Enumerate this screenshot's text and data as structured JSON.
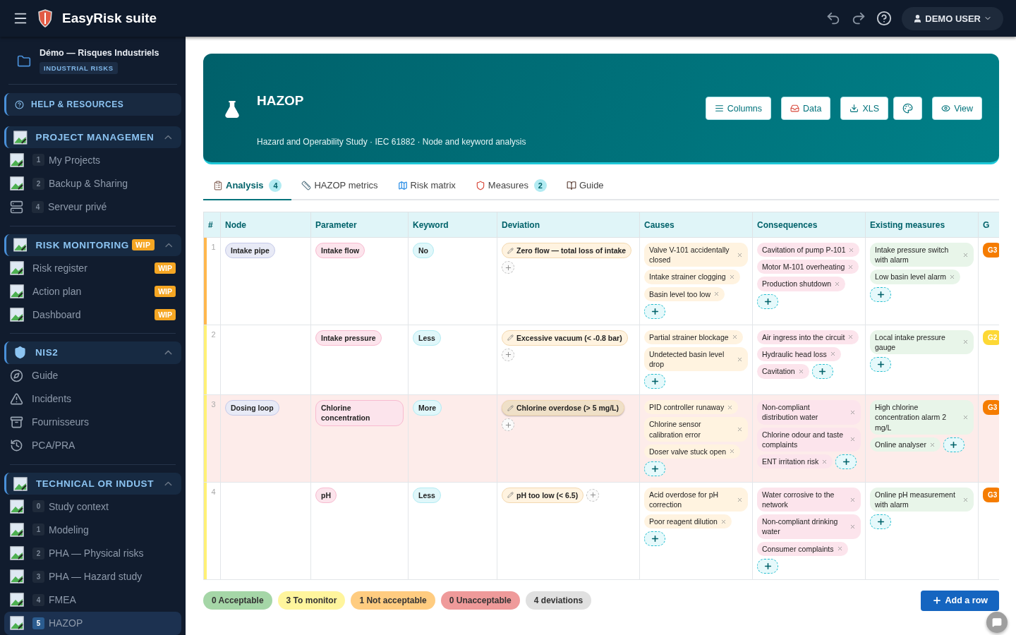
{
  "app": {
    "title": "EasyRisk suite",
    "user": "DEMO USER"
  },
  "project": {
    "name": "Démo — Risques Industriels",
    "tag": "INDUSTRIAL RISKS"
  },
  "help": {
    "label": "HELP & RESOURCES"
  },
  "sidebar": {
    "sections": [
      {
        "title": "PROJECT MANAGEMEN",
        "kind": "image",
        "expanded": true,
        "items": [
          {
            "label": "My Projects",
            "number": "1",
            "kind": "image",
            "selected": false
          },
          {
            "label": "Backup & Sharing",
            "number": "2",
            "kind": "image",
            "selected": false
          },
          {
            "label": "Serveur privé",
            "number": "4",
            "kind": "server",
            "selected": false
          }
        ]
      },
      {
        "title": "RISK MONITORING",
        "badge": "WIP",
        "kind": "image",
        "expanded": true,
        "items": [
          {
            "label": "Risk register",
            "badge": "WIP",
            "kind": "image",
            "selected": false
          },
          {
            "label": "Action plan",
            "badge": "WIP",
            "kind": "image",
            "selected": false
          },
          {
            "label": "Dashboard",
            "badge": "WIP",
            "kind": "image",
            "selected": false
          }
        ]
      },
      {
        "title": "NIS2",
        "kind": "shield",
        "expanded": true,
        "items": [
          {
            "label": "Guide",
            "kind": "compass",
            "selected": false
          },
          {
            "label": "Incidents",
            "kind": "warning",
            "selected": false
          },
          {
            "label": "Fournisseurs",
            "kind": "archive",
            "selected": false
          },
          {
            "label": "PCA/PRA",
            "kind": "history",
            "selected": false
          }
        ]
      },
      {
        "title": "TECHNICAL OR INDUST",
        "kind": "image",
        "expanded": true,
        "items": [
          {
            "label": "Study context",
            "number": "0",
            "kind": "image",
            "selected": false
          },
          {
            "label": "Modeling",
            "number": "1",
            "kind": "image",
            "selected": false
          },
          {
            "label": "PHA — Physical risks",
            "number": "2",
            "kind": "image",
            "selected": false
          },
          {
            "label": "PHA — Hazard study",
            "number": "3",
            "kind": "image",
            "selected": false
          },
          {
            "label": "FMEA",
            "number": "4",
            "kind": "image",
            "selected": false
          },
          {
            "label": "HAZOP",
            "number": "5",
            "kind": "image",
            "selected": true
          }
        ]
      }
    ]
  },
  "hero": {
    "title": "HAZOP",
    "subtitle": "Hazard and Operability Study · IEC 61882 · Node and keyword analysis",
    "buttons": [
      {
        "label": "Columns",
        "kind": "menu"
      },
      {
        "label": "Data",
        "kind": "inbox"
      },
      {
        "label": "XLS",
        "kind": "download"
      },
      {
        "kind": "palette"
      },
      {
        "label": "View",
        "kind": "eye"
      }
    ]
  },
  "tabs": [
    {
      "label": "Analysis",
      "kind": "clipboard",
      "count": "4",
      "selected": true
    },
    {
      "label": "HAZOP metrics",
      "kind": "ruler",
      "selected": false
    },
    {
      "label": "Risk matrix",
      "kind": "map",
      "selected": false
    },
    {
      "label": "Measures",
      "kind": "shield",
      "count": "2",
      "selected": false
    },
    {
      "label": "Guide",
      "kind": "book",
      "selected": false
    }
  ],
  "table": {
    "columns": [
      "#",
      "Node",
      "Parameter",
      "Keyword",
      "Deviation",
      "Causes",
      "Consequences",
      "Existing measures",
      "G"
    ],
    "rows": [
      {
        "number": "1",
        "color": "#ffb74d",
        "highlighted": false,
        "node": "Intake pipe",
        "parameter": "Intake flow",
        "keyword": "No",
        "deviation": {
          "text": "Zero flow — total loss of intake",
          "selected": false
        },
        "causes": [
          "Valve V-101 accidentally closed",
          "Intake strainer clogging",
          "Basin level too low"
        ],
        "consequences": [
          "Cavitation of pump P-101",
          "Motor M-101 overheating",
          "Production shutdown"
        ],
        "measures": [
          "Intake pressure switch with alarm",
          "Low basin level alarm"
        ],
        "severity": {
          "label": "G3",
          "color": "#f57c00"
        }
      },
      {
        "number": "2",
        "color": "#fff176",
        "highlighted": false,
        "parameter": "Intake pressure",
        "keyword": "Less",
        "deviation": {
          "text": "Excessive vacuum (< -0.8 bar)",
          "selected": false
        },
        "causes": [
          "Partial strainer blockage",
          "Undetected basin level drop"
        ],
        "consequences": [
          "Air ingress into the circuit",
          "Hydraulic head loss",
          "Cavitation"
        ],
        "measures": [
          "Local intake pressure gauge"
        ],
        "severity": {
          "label": "G2",
          "color": "#fdd835"
        }
      },
      {
        "number": "3",
        "color": "#fff176",
        "highlighted": true,
        "node": "Dosing loop",
        "parameter": "Chlorine concentration",
        "keyword": "More",
        "deviation": {
          "text": "Chlorine overdose (> 5 mg/L)",
          "selected": true
        },
        "causes": [
          "PID controller runaway",
          "Chlorine sensor calibration error",
          "Doser valve stuck open"
        ],
        "consequences": [
          "Non-compliant distribution water",
          "Chlorine odour and taste complaints",
          "ENT irritation risk"
        ],
        "measures": [
          "High chlorine concentration alarm 2 mg/L",
          "Online analyser"
        ],
        "severity": {
          "label": "G3",
          "color": "#f57c00"
        }
      },
      {
        "number": "4",
        "color": "#fff176",
        "highlighted": false,
        "parameter": "pH",
        "keyword": "Less",
        "deviation": {
          "text": "pH too low (< 6.5)",
          "selected": false
        },
        "causes": [
          "Acid overdose for pH correction",
          "Poor reagent dilution"
        ],
        "consequences": [
          "Water corrosive to the network",
          "Non-compliant drinking water",
          "Consumer complaints"
        ],
        "measures": [
          "Online pH measurement with alarm"
        ],
        "severity": {
          "label": "G3",
          "color": "#f57c00"
        }
      }
    ]
  },
  "summary": [
    {
      "label": "0 Acceptable",
      "color": "#a5d6a7"
    },
    {
      "label": "3 To monitor",
      "color": "#fff59d"
    },
    {
      "label": "1 Not acceptable",
      "color": "#ffcc80"
    },
    {
      "label": "0 Unacceptable",
      "color": "#ef9a9a"
    },
    {
      "label": "4 deviations",
      "color": "#e0e0e0"
    }
  ],
  "add_button": {
    "label": "Add a row"
  }
}
